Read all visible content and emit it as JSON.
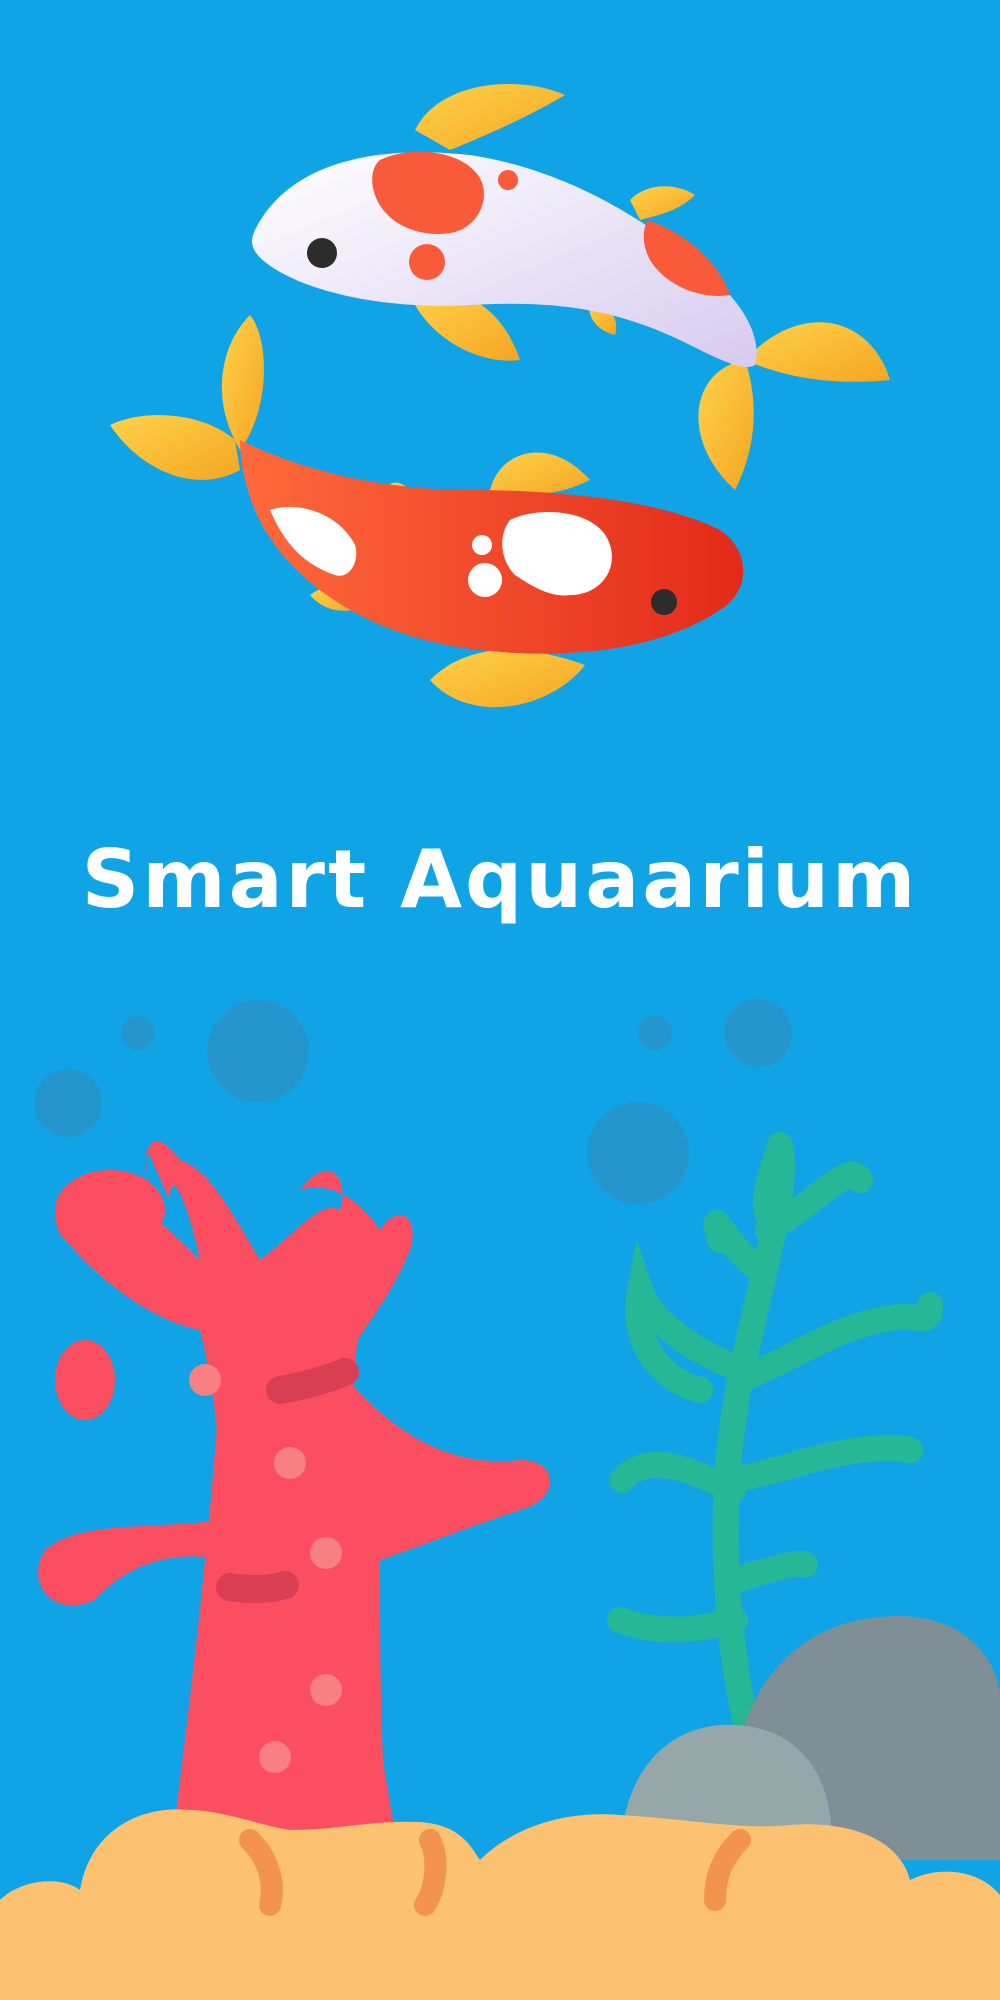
{
  "splash": {
    "app_title": "Smart Aquaarium"
  },
  "icons": {
    "logo": "koi-fish-pair-icon",
    "illustration": [
      "coral-icon",
      "seaweed-icon",
      "rock-icon",
      "sand-icon",
      "bubble-icon"
    ]
  },
  "colors": {
    "background": "#10a4e6",
    "title_text": "#ffffff",
    "koi_white_body": "#f1ecfa",
    "koi_red_body": "#f23a1f",
    "koi_fin": "#fbbf2e",
    "coral": "#fc4e61",
    "seaweed": "#25b796",
    "rock_dark": "#7e9095",
    "rock_light": "#95a7a9",
    "sand": "#fcc272"
  }
}
